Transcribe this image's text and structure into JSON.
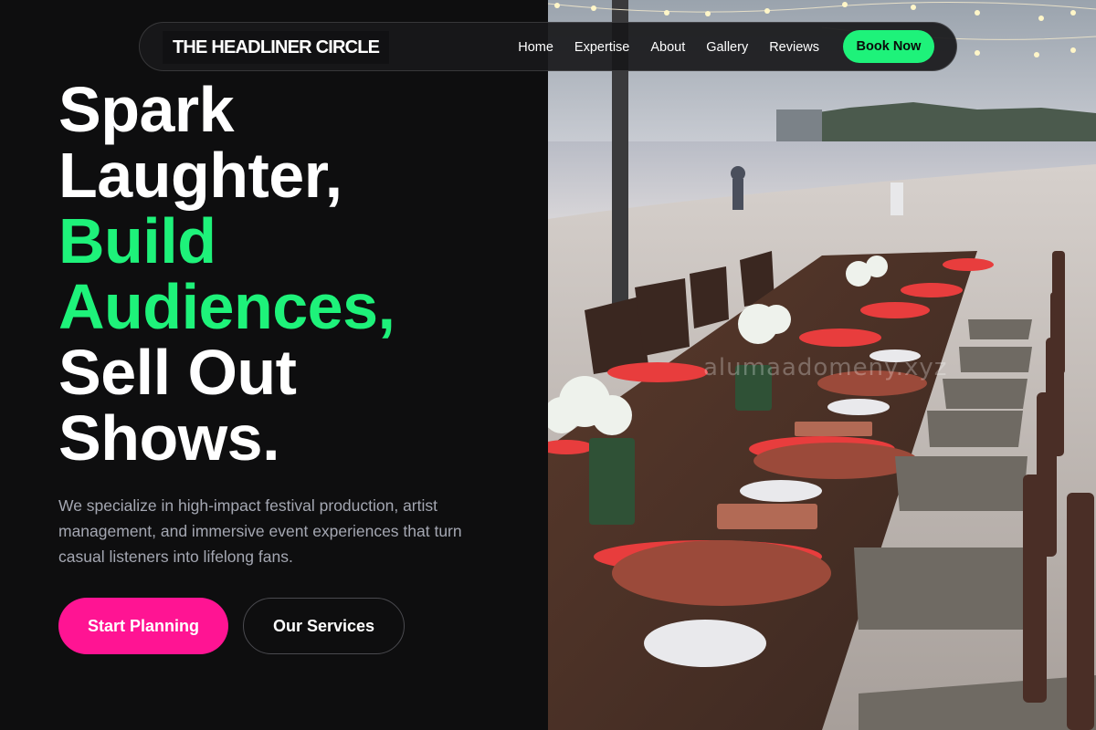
{
  "brand": {
    "name": "THE HEADLINER CIRCLE"
  },
  "nav": {
    "links": [
      "Home",
      "Expertise",
      "About",
      "Gallery",
      "Reviews"
    ],
    "cta_label": "Book Now"
  },
  "hero": {
    "headline_lines": [
      {
        "text": "Spark",
        "accent": false
      },
      {
        "text": "Laughter,",
        "accent": false
      },
      {
        "text": "Build",
        "accent": true
      },
      {
        "text": "Audiences,",
        "accent": true
      },
      {
        "text": "Sell Out",
        "accent": false
      },
      {
        "text": "Shows.",
        "accent": false
      }
    ],
    "description": "We specialize in high-impact festival production, artist management, and immersive event experiences that turn casual listeners into lifelong fans.",
    "primary_button": "Start Planning",
    "secondary_button": "Our Services"
  },
  "image": {
    "subject": "photo-beach-dinner-table",
    "watermark": "alumaadomeny.xyz"
  },
  "colors": {
    "background": "#0e0e0f",
    "accent_green": "#1ef27a",
    "accent_pink": "#ff1493",
    "text_muted": "#a4a7b2"
  }
}
